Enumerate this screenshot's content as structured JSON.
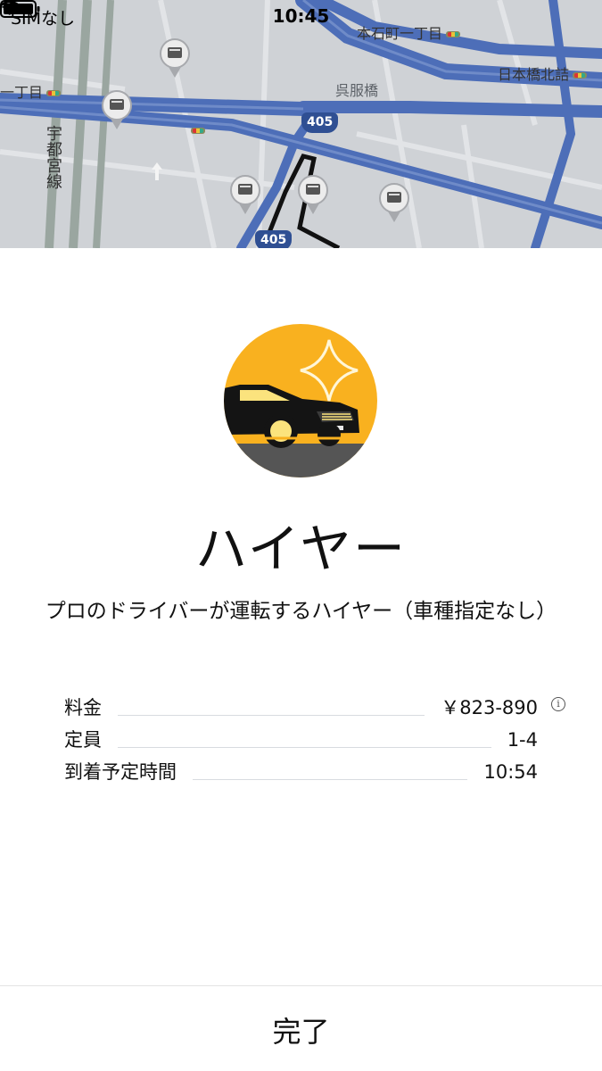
{
  "status_bar": {
    "carrier": "SIMなし",
    "time": "10:45"
  },
  "map": {
    "labels": {
      "hongokucho": "本石町一丁目",
      "chome_left": "一丁目",
      "gofukubashi": "呉服橋",
      "nihonbashi_kitazume": "日本橋北詰",
      "line": "宇都宮線"
    },
    "route_numbers": [
      "405",
      "405"
    ]
  },
  "product": {
    "image_icon": "black-sedan-on-yellow-circle-icon",
    "name": "ハイヤー",
    "description": "プロのドライバーが運転するハイヤー（車種指定なし）"
  },
  "details": {
    "fare_label": "料金",
    "fare_value": "￥823-890",
    "capacity_label": "定員",
    "capacity_value": "1-4",
    "eta_label": "到着予定時間",
    "eta_value": "10:54"
  },
  "footer": {
    "done_label": "完了"
  },
  "colors": {
    "accent_yellow": "#f9b11f",
    "map_bg": "#cfd2d6",
    "road_blue": "#4d6eb8"
  }
}
